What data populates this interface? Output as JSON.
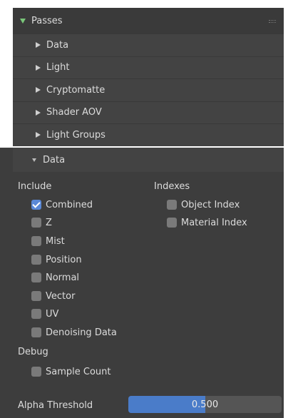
{
  "passes_panel": {
    "title": "Passes",
    "subpanels": [
      {
        "label": "Data"
      },
      {
        "label": "Light"
      },
      {
        "label": "Cryptomatte"
      },
      {
        "label": "Shader AOV"
      },
      {
        "label": "Light Groups"
      }
    ]
  },
  "data_panel": {
    "title": "Data",
    "include_label": "Include",
    "include_items": [
      {
        "label": "Combined",
        "checked": true
      },
      {
        "label": "Z",
        "checked": false
      },
      {
        "label": "Mist",
        "checked": false
      },
      {
        "label": "Position",
        "checked": false
      },
      {
        "label": "Normal",
        "checked": false
      },
      {
        "label": "Vector",
        "checked": false
      },
      {
        "label": "UV",
        "checked": false
      },
      {
        "label": "Denoising Data",
        "checked": false
      }
    ],
    "indexes_label": "Indexes",
    "index_items": [
      {
        "label": "Object Index",
        "checked": false
      },
      {
        "label": "Material Index",
        "checked": false
      }
    ],
    "debug_label": "Debug",
    "debug_items": [
      {
        "label": "Sample Count",
        "checked": false
      }
    ],
    "alpha_threshold": {
      "label": "Alpha Threshold",
      "value_text": "0.500",
      "value": 0.5
    }
  },
  "colors": {
    "panel_bg": "#3d3d3d",
    "checkbox_on": "#5a88d6",
    "slider_fill": "#4a7cc9",
    "expand_arrow": "#7ac77a"
  }
}
